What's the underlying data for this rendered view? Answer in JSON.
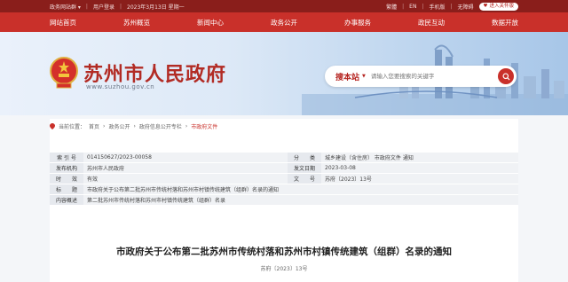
{
  "topbar": {
    "switch_label": "政务网站群 ▾",
    "login_label": "用户登录",
    "date": "2023年3月13日 星期一",
    "lang_cn": "繁體",
    "lang_en": "EN",
    "mobile": "手机版",
    "barrier": "无障碍",
    "care_label": "进入关怀版"
  },
  "nav": [
    "网站首页",
    "苏州概览",
    "新闻中心",
    "政务公开",
    "办事服务",
    "政民互动",
    "数据开放"
  ],
  "site": {
    "title": "苏州市人民政府",
    "url": "www.suzhou.gov.cn"
  },
  "search": {
    "brand": "搜本站",
    "placeholder": "请输入您要搜索的关键字"
  },
  "breadcrumb": [
    "首页",
    "政务公开",
    "政府信息公开专栏",
    "市政府文件"
  ],
  "meta": {
    "index_k": "索 引 号",
    "index_v": "014150627/2023-00058",
    "class_k": "分　　类",
    "class_v": "城乡建设（含住房）  市政府文件  通知",
    "issuer_k": "发布机构",
    "issuer_v": "苏州市人民政府",
    "date_k": "发文日期",
    "date_v": "2023-03-08",
    "valid_k": "时　　效",
    "valid_v": "有效",
    "docno_k": "文　　号",
    "docno_v": "苏府〔2023〕13号",
    "title_k": "标　　题",
    "title_v": "市政府关于公布第二批苏州市传统村落和苏州市村镇传统建筑（组群）名录的通知",
    "summary_k": "内容概述",
    "summary_v": "第二批苏州市传统村落和苏州市村镇传统建筑（组群）名录"
  },
  "doc": {
    "title": "市政府关于公布第二批苏州市传统村落和苏州市村镇传统建筑（组群）名录的通知",
    "number": "苏府〔2023〕13号"
  },
  "colors": {
    "primary": "#c9302a",
    "topbar": "#8a1e1b"
  }
}
